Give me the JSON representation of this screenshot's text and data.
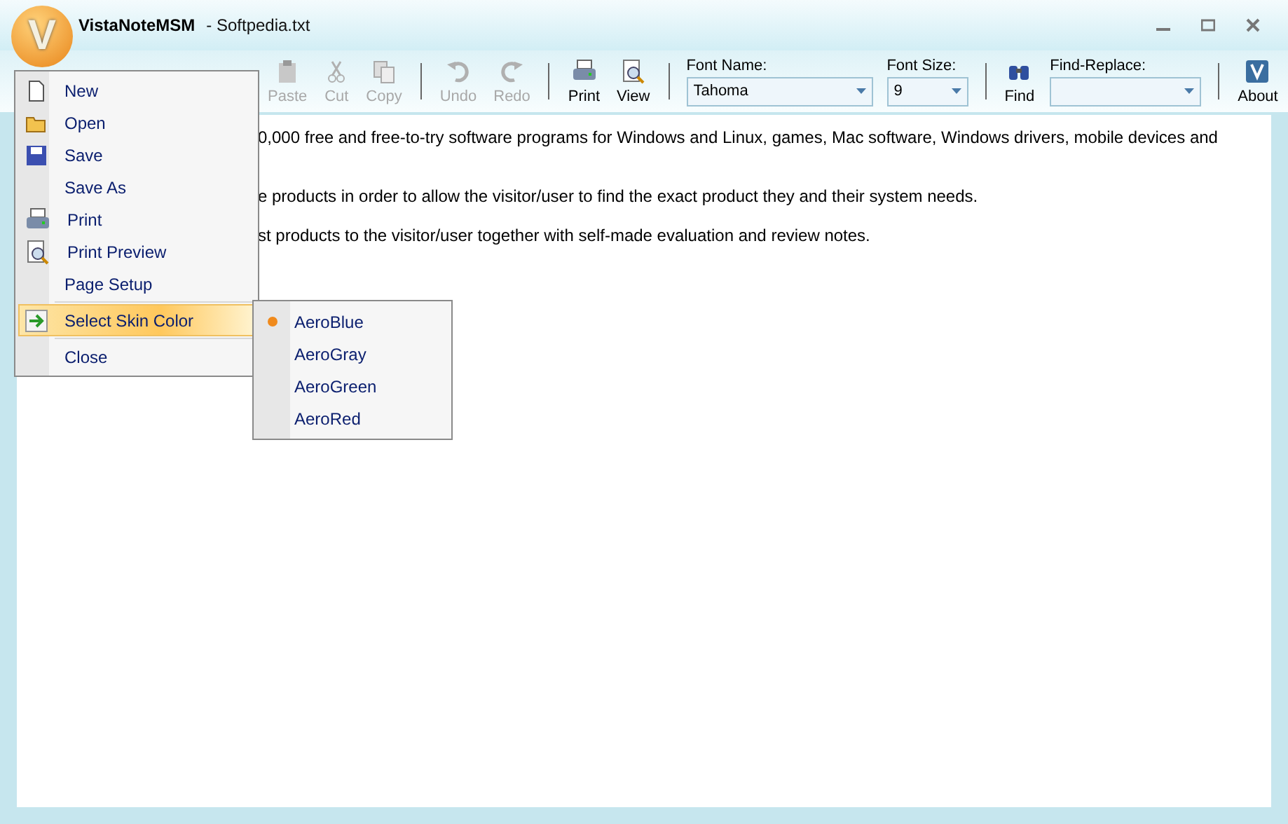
{
  "window": {
    "logo_letter": "V",
    "app_name": "VistaNoteMSM",
    "document": "- Softpedia.txt"
  },
  "toolbar": [
    {
      "kind": "button",
      "label": "Paste",
      "disabled": true
    },
    {
      "kind": "button",
      "label": "Cut",
      "disabled": true
    },
    {
      "kind": "button",
      "label": "Copy",
      "disabled": true
    },
    {
      "kind": "separator"
    },
    {
      "kind": "button",
      "label": "Undo",
      "disabled": true
    },
    {
      "kind": "button",
      "label": "Redo",
      "disabled": true
    },
    {
      "kind": "separator"
    },
    {
      "kind": "button",
      "label": "Print",
      "disabled": false
    },
    {
      "kind": "button",
      "label": "View",
      "disabled": false
    },
    {
      "kind": "separator"
    },
    {
      "kind": "combo",
      "label": "Font Name:",
      "value": "Tahoma"
    },
    {
      "kind": "combo",
      "label": "Font Size:",
      "value": "9"
    },
    {
      "kind": "separator"
    },
    {
      "kind": "button",
      "label": "Find",
      "disabled": false
    },
    {
      "kind": "combo",
      "label": "Find-Replace:"
    },
    {
      "kind": "separator"
    },
    {
      "kind": "button",
      "label": "About",
      "disabled": false
    }
  ],
  "editor_lines": [
    "0,000 free and free-to-try software programs for Windows and Linux, games, Mac software, Windows drivers, mobile devices and",
    "e products in order to allow the visitor/user to find the exact product they and their system needs.",
    "st products to the visitor/user together with self-made evaluation and review notes."
  ],
  "menu": [
    {
      "label": "New",
      "selected": false
    },
    {
      "label": "Open",
      "selected": false
    },
    {
      "label": "Save",
      "selected": false
    },
    {
      "label": "Save As",
      "selected": false
    },
    {
      "label": "Print",
      "selected": false
    },
    {
      "label": "Print Preview",
      "selected": false
    },
    {
      "label": "Page Setup",
      "selected": false
    },
    {
      "label": "Select Skin Color",
      "selected": true
    },
    {
      "label": "Close",
      "selected": false
    }
  ],
  "submenu": [
    {
      "label": "AeroBlue",
      "selected": true
    },
    {
      "label": "AeroGray",
      "selected": false
    },
    {
      "label": "AeroGreen",
      "selected": false
    },
    {
      "label": "AeroRed",
      "selected": false
    }
  ]
}
